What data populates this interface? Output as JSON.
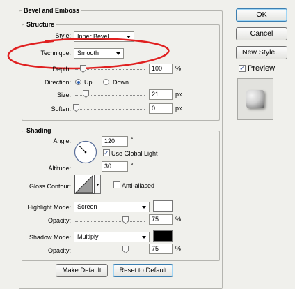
{
  "bevel": {
    "title": "Bevel and Emboss",
    "structure": {
      "title": "Structure",
      "style_label": "Style:",
      "style_value": "Inner Bevel",
      "technique_label": "Technique:",
      "technique_value": "Smooth",
      "depth_label": "Depth:",
      "depth_value": "100",
      "depth_unit": "%",
      "direction_label": "Direction:",
      "direction_up": "Up",
      "direction_down": "Down",
      "size_label": "Size:",
      "size_value": "21",
      "size_unit": "px",
      "soften_label": "Soften:",
      "soften_value": "0",
      "soften_unit": "px"
    },
    "shading": {
      "title": "Shading",
      "angle_label": "Angle:",
      "angle_value": "120",
      "angle_unit": "°",
      "global_light_label": "Use Global Light",
      "altitude_label": "Altitude:",
      "altitude_value": "30",
      "altitude_unit": "°",
      "gloss_label": "Gloss Contour:",
      "anti_aliased_label": "Anti-aliased",
      "highlight_mode_label": "Highlight Mode:",
      "highlight_mode_value": "Screen",
      "highlight_color": "#ffffff",
      "highlight_opacity_label": "Opacity:",
      "highlight_opacity_value": "75",
      "highlight_opacity_unit": "%",
      "shadow_mode_label": "Shadow Mode:",
      "shadow_mode_value": "Multiply",
      "shadow_color": "#000000",
      "shadow_opacity_label": "Opacity:",
      "shadow_opacity_value": "75",
      "shadow_opacity_unit": "%"
    },
    "make_default": "Make Default",
    "reset_default": "Reset to Default"
  },
  "buttons": {
    "ok": "OK",
    "cancel": "Cancel",
    "new_style": "New Style...",
    "preview_label": "Preview"
  },
  "annotation_color": "#e02020"
}
